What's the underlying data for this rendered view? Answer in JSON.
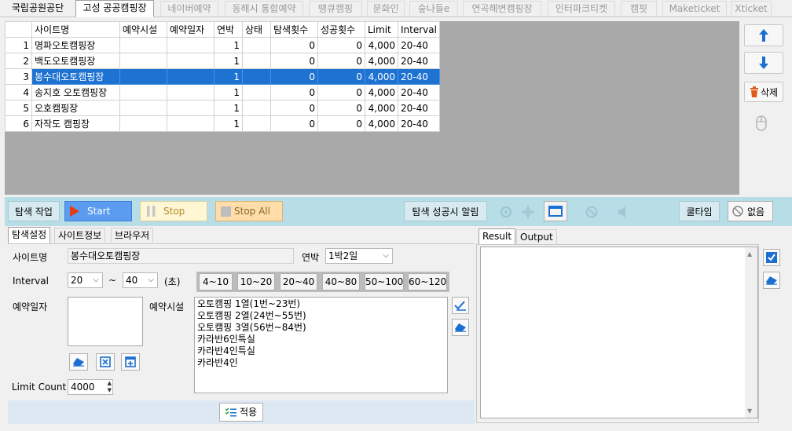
{
  "tabs": [
    {
      "label": "국립공원공단",
      "state": "first"
    },
    {
      "label": "고성 공공캠핑장",
      "state": "active"
    },
    {
      "label": "네이버예약",
      "state": "inactive"
    },
    {
      "label": "동해시 통합예약",
      "state": "inactive"
    },
    {
      "label": "땡큐캠핑",
      "state": "inactive"
    },
    {
      "label": "문화인",
      "state": "inactive"
    },
    {
      "label": "숲나들e",
      "state": "inactive"
    },
    {
      "label": "연곡해변캠핑장",
      "state": "inactive"
    },
    {
      "label": "인터파크티켓",
      "state": "inactive"
    },
    {
      "label": "캠핏",
      "state": "inactive"
    },
    {
      "label": "Maketicket",
      "state": "inactive"
    },
    {
      "label": "Xticket",
      "state": "inactive"
    }
  ],
  "grid": {
    "columns": [
      "사이트명",
      "예약시설",
      "예약일자",
      "연박",
      "상태",
      "탐색횟수",
      "성공횟수",
      "Limit",
      "Interval"
    ],
    "rows": [
      {
        "no": "1",
        "cells": [
          "명파오토캠핑장",
          "",
          "",
          "1",
          "",
          "0",
          "0",
          "4,000",
          "20-40"
        ],
        "selected": false
      },
      {
        "no": "2",
        "cells": [
          "백도오토캠핑장",
          "",
          "",
          "1",
          "",
          "0",
          "0",
          "4,000",
          "20-40"
        ],
        "selected": false
      },
      {
        "no": "3",
        "cells": [
          "봉수대오토캠핑장",
          "",
          "",
          "1",
          "",
          "0",
          "0",
          "4,000",
          "20-40"
        ],
        "selected": true
      },
      {
        "no": "4",
        "cells": [
          "송지호 오토캠핑장",
          "",
          "",
          "1",
          "",
          "0",
          "0",
          "4,000",
          "20-40"
        ],
        "selected": false
      },
      {
        "no": "5",
        "cells": [
          "오호캠핑장",
          "",
          "",
          "1",
          "",
          "0",
          "0",
          "4,000",
          "20-40"
        ],
        "selected": false
      },
      {
        "no": "6",
        "cells": [
          "자작도 캠핑장",
          "",
          "",
          "1",
          "",
          "0",
          "0",
          "4,000",
          "20-40"
        ],
        "selected": false
      }
    ]
  },
  "side": {
    "delete_label": "삭제"
  },
  "toolbar": {
    "search_job_label": "탐색 작업",
    "start_label": "Start",
    "stop_label": "Stop",
    "stop_all_label": "Stop All",
    "success_alert_label": "탐색 성공시 알림",
    "cooltime_label": "쿨타임",
    "none_label": "없음"
  },
  "panel": {
    "tabs": [
      "탐색설정",
      "사이트정보",
      "브라우저"
    ],
    "site_name_label": "사이트명",
    "site_name_value": "봉수대오토캠핑장",
    "stay_label": "연박",
    "stay_value": "1박2일",
    "interval_label": "Interval",
    "interval_from": "20",
    "interval_tilde": "~",
    "interval_to": "40",
    "interval_unit": "(초)",
    "ranges": [
      "4~10",
      "10~20",
      "20~40",
      "40~80",
      "50~100",
      "60~120"
    ],
    "date_label": "예약일자",
    "facility_label": "예약시설",
    "facilities": [
      "오토캠핑 1열(1번~23번)",
      "오토캠핑 2열(24번~55번)",
      "오토캠핑 3열(56번~84번)",
      "카라반6인특실",
      "카라반4인특실",
      "카라반4인"
    ],
    "limit_label": "Limit Count",
    "limit_value": "4000",
    "apply_label": "적용"
  },
  "result": {
    "tabs": [
      "Result",
      "Output"
    ]
  },
  "colors": {
    "selection": "#1e73d2",
    "toolbar_bg": "#b7dde6",
    "accent_blue": "#1a6fd0",
    "start_bg": "#5b9cf0",
    "stop_bg": "#fff7d4",
    "stop_all_bg": "#ffdca8"
  }
}
